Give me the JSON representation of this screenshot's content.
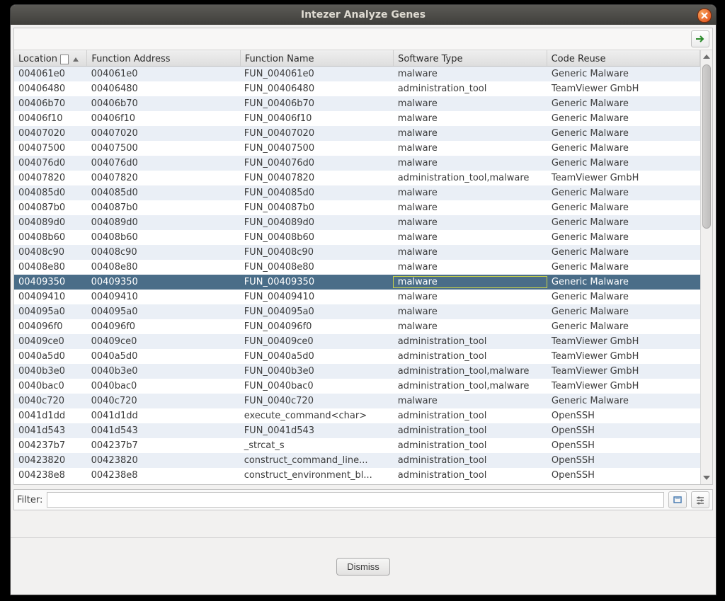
{
  "window": {
    "title": "Intezer Analyze Genes"
  },
  "columns": [
    "Location",
    "Function Address",
    "Function Name",
    "Software Type",
    "Code Reuse"
  ],
  "sort_column_index": 0,
  "sort_direction": "asc",
  "selected_row_index": 14,
  "rows": [
    {
      "loc": "004061e0",
      "addr": "004061e0",
      "fn": "FUN_004061e0",
      "type": "malware",
      "reuse": "Generic Malware"
    },
    {
      "loc": "00406480",
      "addr": "00406480",
      "fn": "FUN_00406480",
      "type": "administration_tool",
      "reuse": "TeamViewer GmbH"
    },
    {
      "loc": "00406b70",
      "addr": "00406b70",
      "fn": "FUN_00406b70",
      "type": "malware",
      "reuse": "Generic Malware"
    },
    {
      "loc": "00406f10",
      "addr": "00406f10",
      "fn": "FUN_00406f10",
      "type": "malware",
      "reuse": "Generic Malware"
    },
    {
      "loc": "00407020",
      "addr": "00407020",
      "fn": "FUN_00407020",
      "type": "malware",
      "reuse": "Generic Malware"
    },
    {
      "loc": "00407500",
      "addr": "00407500",
      "fn": "FUN_00407500",
      "type": "malware",
      "reuse": "Generic Malware"
    },
    {
      "loc": "004076d0",
      "addr": "004076d0",
      "fn": "FUN_004076d0",
      "type": "malware",
      "reuse": "Generic Malware"
    },
    {
      "loc": "00407820",
      "addr": "00407820",
      "fn": "FUN_00407820",
      "type": "administration_tool,malware",
      "reuse": "TeamViewer GmbH"
    },
    {
      "loc": "004085d0",
      "addr": "004085d0",
      "fn": "FUN_004085d0",
      "type": "malware",
      "reuse": "Generic Malware"
    },
    {
      "loc": "004087b0",
      "addr": "004087b0",
      "fn": "FUN_004087b0",
      "type": "malware",
      "reuse": "Generic Malware"
    },
    {
      "loc": "004089d0",
      "addr": "004089d0",
      "fn": "FUN_004089d0",
      "type": "malware",
      "reuse": "Generic Malware"
    },
    {
      "loc": "00408b60",
      "addr": "00408b60",
      "fn": "FUN_00408b60",
      "type": "malware",
      "reuse": "Generic Malware"
    },
    {
      "loc": "00408c90",
      "addr": "00408c90",
      "fn": "FUN_00408c90",
      "type": "malware",
      "reuse": "Generic Malware"
    },
    {
      "loc": "00408e80",
      "addr": "00408e80",
      "fn": "FUN_00408e80",
      "type": "malware",
      "reuse": "Generic Malware"
    },
    {
      "loc": "00409350",
      "addr": "00409350",
      "fn": "FUN_00409350",
      "type": "malware",
      "reuse": "Generic Malware"
    },
    {
      "loc": "00409410",
      "addr": "00409410",
      "fn": "FUN_00409410",
      "type": "malware",
      "reuse": "Generic Malware"
    },
    {
      "loc": "004095a0",
      "addr": "004095a0",
      "fn": "FUN_004095a0",
      "type": "malware",
      "reuse": "Generic Malware"
    },
    {
      "loc": "004096f0",
      "addr": "004096f0",
      "fn": "FUN_004096f0",
      "type": "malware",
      "reuse": "Generic Malware"
    },
    {
      "loc": "00409ce0",
      "addr": "00409ce0",
      "fn": "FUN_00409ce0",
      "type": "administration_tool",
      "reuse": "TeamViewer GmbH"
    },
    {
      "loc": "0040a5d0",
      "addr": "0040a5d0",
      "fn": "FUN_0040a5d0",
      "type": "administration_tool",
      "reuse": "TeamViewer GmbH"
    },
    {
      "loc": "0040b3e0",
      "addr": "0040b3e0",
      "fn": "FUN_0040b3e0",
      "type": "administration_tool,malware",
      "reuse": "TeamViewer GmbH"
    },
    {
      "loc": "0040bac0",
      "addr": "0040bac0",
      "fn": "FUN_0040bac0",
      "type": "administration_tool,malware",
      "reuse": "TeamViewer GmbH"
    },
    {
      "loc": "0040c720",
      "addr": "0040c720",
      "fn": "FUN_0040c720",
      "type": "malware",
      "reuse": "Generic Malware"
    },
    {
      "loc": "0041d1dd",
      "addr": "0041d1dd",
      "fn": "execute_command<char>",
      "type": "administration_tool",
      "reuse": "OpenSSH"
    },
    {
      "loc": "0041d543",
      "addr": "0041d543",
      "fn": "FUN_0041d543",
      "type": "administration_tool",
      "reuse": "OpenSSH"
    },
    {
      "loc": "004237b7",
      "addr": "004237b7",
      "fn": "_strcat_s",
      "type": "administration_tool",
      "reuse": "OpenSSH"
    },
    {
      "loc": "00423820",
      "addr": "00423820",
      "fn": "construct_command_line...",
      "type": "administration_tool",
      "reuse": "OpenSSH"
    },
    {
      "loc": "004238e8",
      "addr": "004238e8",
      "fn": "construct_environment_bl...",
      "type": "administration_tool",
      "reuse": "OpenSSH"
    }
  ],
  "filter": {
    "label": "Filter:",
    "value": ""
  },
  "buttons": {
    "dismiss": "Dismiss"
  }
}
